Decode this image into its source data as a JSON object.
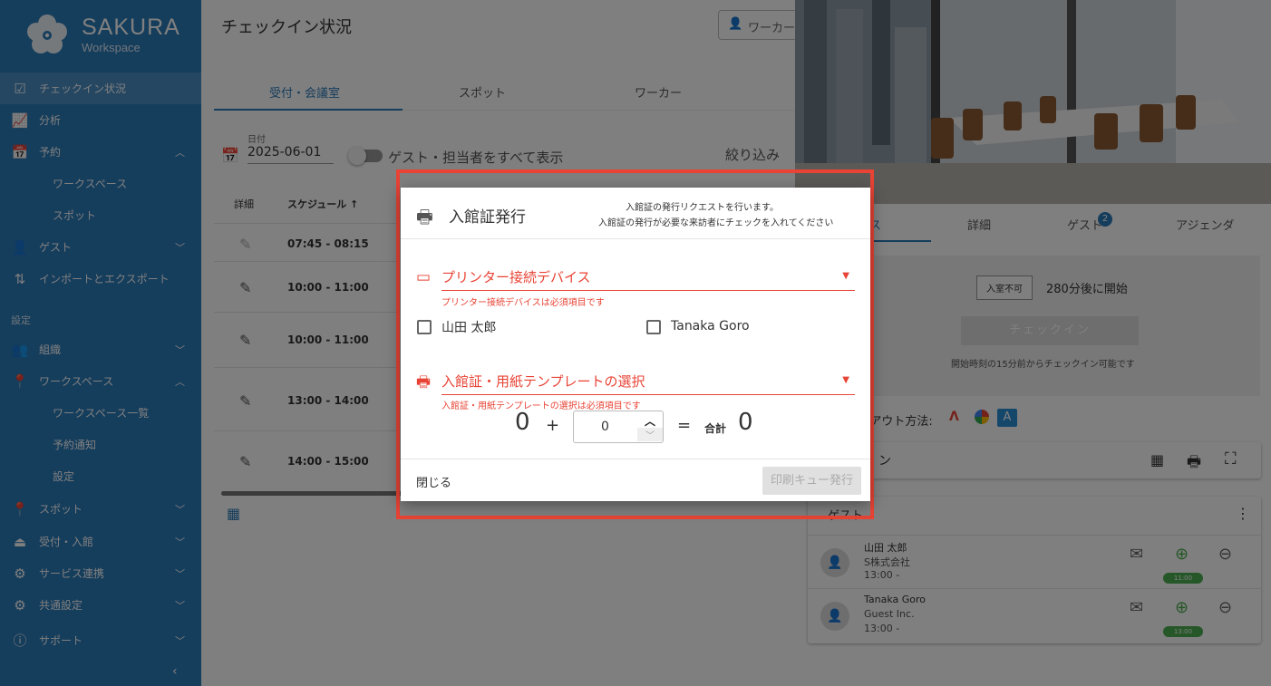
{
  "sidebar": {
    "logo_name": "SAKURA",
    "logo_sub": "Workspace",
    "items": [
      {
        "label": "チェックイン状況",
        "icon": "checkbox-icon"
      },
      {
        "label": "分析",
        "icon": "chart-icon"
      },
      {
        "label": "予約",
        "icon": "calendar-icon"
      },
      {
        "label": "ワークスペース"
      },
      {
        "label": "スポット"
      },
      {
        "label": "ゲスト",
        "icon": "guest-icon"
      },
      {
        "label": "インポートとエクスポート",
        "icon": "import-export-icon"
      },
      {
        "label": "組織",
        "icon": "group-icon"
      },
      {
        "label": "ワークスペース",
        "icon": "location-pin-icon"
      },
      {
        "label": "ワークスペース一覧"
      },
      {
        "label": "予約通知"
      },
      {
        "label": "設定"
      },
      {
        "label": "スポット",
        "icon": "spot-pin-icon"
      },
      {
        "label": "受付・入館",
        "icon": "reception-icon"
      },
      {
        "label": "サービス連携",
        "icon": "services-icon"
      },
      {
        "label": "共通設定",
        "icon": "settings-icon"
      },
      {
        "label": "サポート",
        "icon": "help-icon"
      }
    ],
    "section_settings": "設定",
    "collapse": "‹"
  },
  "main": {
    "title": "チェックイン状況",
    "search_placeholder": "ワーカー",
    "tabs": [
      "受付・会議室",
      "スポット",
      "ワーカー"
    ],
    "date_label": "日付",
    "date_value": "2025-06-01",
    "show_all_label": "ゲスト・担当者をすべて表示",
    "filter_label": "絞り込み",
    "col_detail": "詳細",
    "col_schedule": "スケジュール ↑",
    "rows": [
      {
        "time": "07:45 - 08:15"
      },
      {
        "time": "10:00 - 11:00"
      },
      {
        "time": "10:00 - 11:00"
      },
      {
        "time": "13:00 - 14:00"
      },
      {
        "time": "14:00 - 15:00"
      }
    ]
  },
  "right": {
    "tabs": [
      "ス",
      "詳細",
      "ゲスト",
      "アジェンダ"
    ],
    "guest_badge": "2",
    "no_entry": "入室不可",
    "starts_in": "280分後に開始",
    "checkin_btn": "チェックイン",
    "checkin_note": "開始時刻の15分前からチェックイン可能です",
    "method_label": "/アウト方法:",
    "card1_title": "ン",
    "card2_title": "ゲスト",
    "guests": [
      {
        "name": "山田 太郎",
        "company": "S株式会社",
        "time": "13:00 -",
        "pill": "11:00"
      },
      {
        "name": "Tanaka Goro",
        "company": "Guest Inc.",
        "time": "13:00 -",
        "pill": "13:00"
      }
    ]
  },
  "dialog": {
    "title": "入館証発行",
    "note1": "入館証の発行リクエストを行います。",
    "note2": "入館証の発行が必要な来訪者にチェックを入れてください",
    "printer_label": "プリンター接続デバイス",
    "printer_error": "プリンター接続デバイスは必須項目です",
    "visitors": [
      "山田 太郎",
      "Tanaka Goro"
    ],
    "template_label": "入館証・用紙テンプレートの選択",
    "template_error": "入館証・用紙テンプレートの選択は必須項目です",
    "count_a": "0",
    "plus": "+",
    "extra_value": "0",
    "equals": "=",
    "total_label": "合計",
    "total_value": "0",
    "close_label": "閉じる",
    "print_label": "印刷キュー発行"
  },
  "colors": {
    "sidebar": "#2b7ab8",
    "error": "#e84335",
    "highlight": "#e84335",
    "success": "#4caf50"
  }
}
